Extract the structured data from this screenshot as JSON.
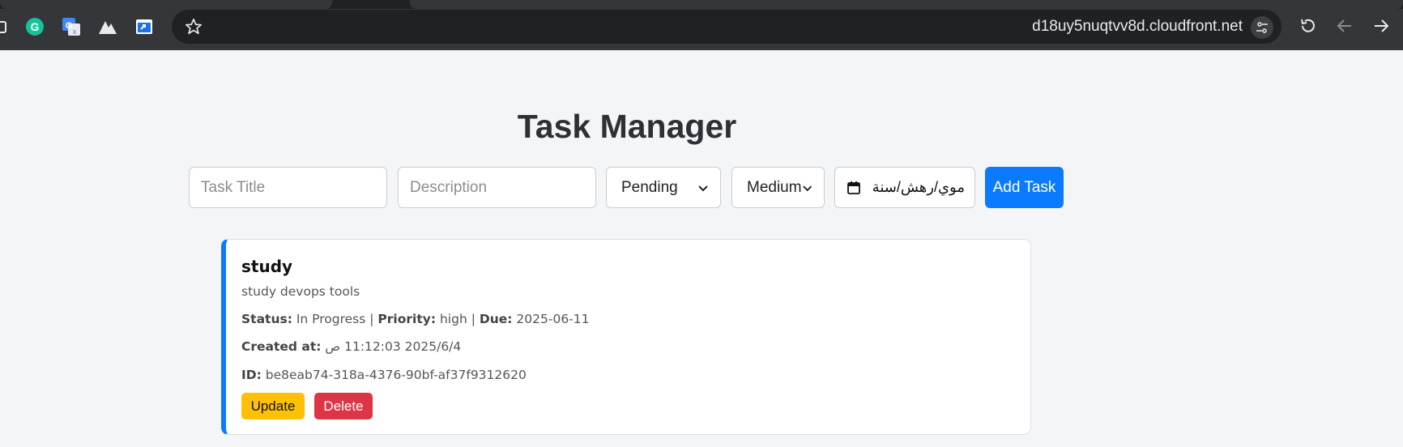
{
  "browser": {
    "url": "d18uy5nuqtvv8d.cloudfront.net",
    "extensions": [
      "puzzle-icon",
      "grammarly-icon",
      "google-translate-icon",
      "mountain-icon",
      "screen-share-icon"
    ]
  },
  "page": {
    "title": "Task Manager"
  },
  "form": {
    "title_placeholder": "Task Title",
    "description_placeholder": "Description",
    "status_value": "Pending",
    "priority_value": "Medium",
    "date_value": "موي/رهش/سنة",
    "add_label": "Add Task"
  },
  "task": {
    "title": "study",
    "description": "study devops tools",
    "status_label": "Status:",
    "status": "In Progress",
    "priority_label": "Priority:",
    "priority": "high",
    "due_label": "Due:",
    "due": "2025-06-11",
    "created_label": "Created at:",
    "created": "2025/6/4 11:12:03 ص",
    "id_label": "ID:",
    "id": "be8eab74-318a-4376-90bf-af37f9312620",
    "update_label": "Update",
    "delete_label": "Delete"
  },
  "colors": {
    "accent": "#0a7bff",
    "update": "#ffc107",
    "delete": "#dc3545"
  }
}
